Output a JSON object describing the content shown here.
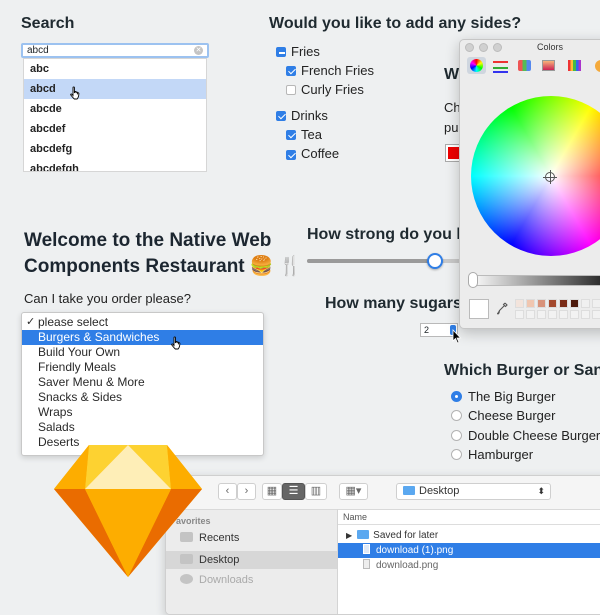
{
  "search": {
    "heading": "Search",
    "value": "abcd",
    "options": [
      "abc",
      "abcd",
      "abcde",
      "abcdef",
      "abcdefg",
      "abcdefgh"
    ],
    "selected_index": 1
  },
  "sides": {
    "heading": "Would you like to add any sides?",
    "groups": [
      {
        "label": "Fries",
        "state": "mixed",
        "items": [
          {
            "label": "French Fries",
            "checked": true
          },
          {
            "label": "Curly Fries",
            "checked": false
          }
        ]
      },
      {
        "label": "Drinks",
        "state": "checked",
        "items": [
          {
            "label": "Tea",
            "checked": true
          },
          {
            "label": "Coffee",
            "checked": true
          }
        ]
      }
    ]
  },
  "partial": {
    "heading_fragment": "W",
    "text_line1": "Ch",
    "text_line2": "pu"
  },
  "welcome": {
    "title": "Welcome to the Native Web Components Restaurant 🍔 🍴",
    "question": "Can I take you order please?"
  },
  "menu": {
    "options": [
      "please select",
      "Burgers & Sandwiches",
      "Build Your Own",
      "Friendly Meals",
      "Saver Menu & More",
      "Snacks & Sides",
      "Wraps",
      "Salads",
      "Deserts"
    ],
    "checked_index": 0,
    "highlighted_index": 1
  },
  "strength": {
    "heading": "How strong do you lik",
    "slider_value_fraction": 0.8
  },
  "sugars": {
    "heading": "How many sugars?",
    "value": "2"
  },
  "burger": {
    "heading": "Which Burger or Sandv",
    "options": [
      "The Big Burger",
      "Cheese Burger",
      "Double Cheese Burger",
      "Hamburger"
    ],
    "selected_index": 0
  },
  "colors_panel": {
    "title": "Colors",
    "selected_color": "#ff0000"
  },
  "finder": {
    "location": "Desktop",
    "sidebar_heading": "avorites",
    "sidebar_items": [
      "Recents",
      "Desktop",
      "Downloads"
    ],
    "column_header": "Name",
    "files": [
      {
        "name": "Saved for later",
        "kind": "folder"
      },
      {
        "name": "download (1).png",
        "kind": "file",
        "selected": true
      },
      {
        "name": "download.png",
        "kind": "file"
      }
    ]
  },
  "colors": {
    "accent": "#2f7ee6",
    "background": "#eef0f1"
  },
  "icons": [
    "sketch-logo-icon",
    "pointer-hand-icon",
    "arrow-cursor-icon",
    "burger-emoji-icon",
    "fork-knife-icon",
    "eyedropper-icon",
    "folder-icon"
  ]
}
